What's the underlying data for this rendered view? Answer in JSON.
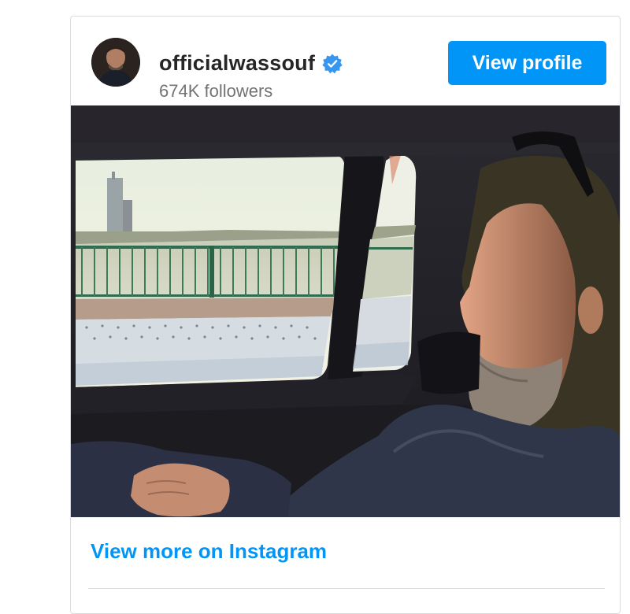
{
  "profile": {
    "username": "officialwassouf",
    "followers": "674K followers",
    "verified": true,
    "avatar_icon": "profile-avatar"
  },
  "actions": {
    "view_profile_label": "View profile",
    "view_more_label": "View more on Instagram"
  },
  "post": {
    "image_icon": "post-photo"
  },
  "colors": {
    "accent": "#0095f6",
    "username_text": "#262626",
    "secondary_text": "#737373",
    "border": "#dbdbdb"
  }
}
